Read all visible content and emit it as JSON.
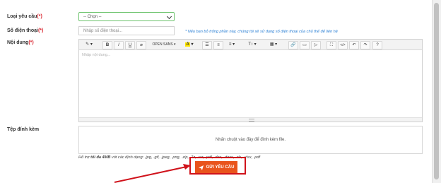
{
  "form": {
    "request_type_label": "Loại yêu cầu",
    "phone_label": "Số điện thoại",
    "content_label": "Nội dung",
    "attachment_label": "Tệp đính kèm",
    "required_mark": "(*)",
    "request_type_value": "-- Chọn --",
    "phone_placeholder": "Nhập số điện thoại...",
    "phone_note": "* Nếu bạn bỏ trống phần này, chúng tôi sẽ sử dụng số điện thoại của chủ thể để liên hệ",
    "content_placeholder": "Nhập nội dung...",
    "drop_text": "Nhấn chuột vào đây để đính kèm file.",
    "support_prefix": "Hỗ trợ",
    "support_max": "tối đa 4MB",
    "support_suffix": "với các định dạng: .jpg, .gif, .jpeg, .png, .zip, .7z, .rar, .pdf, .doc, .docx, .xls, .xlsx, .pdf",
    "submit_label": "GỬI YÊU CẦU",
    "submit_icon": "paper-plane-icon"
  },
  "toolbar": {
    "magic": "✎",
    "bold": "B",
    "italic": "I",
    "underline": "U",
    "eraser": "⌀",
    "font_name": "OPEN SANS",
    "color": "A",
    "ul": "☰",
    "ol": "≡",
    "para": "≡",
    "height": "T↕",
    "table": "▦",
    "link": "🔗",
    "image": "▭",
    "video": "▷",
    "fullscreen": "⛶",
    "code": "</>",
    "undo": "↶",
    "redo": "↷",
    "help": "?"
  },
  "colors": {
    "accent": "#e9541c",
    "highlight": "#d0121b",
    "note": "#2a7fd4",
    "required": "#d9232d"
  }
}
